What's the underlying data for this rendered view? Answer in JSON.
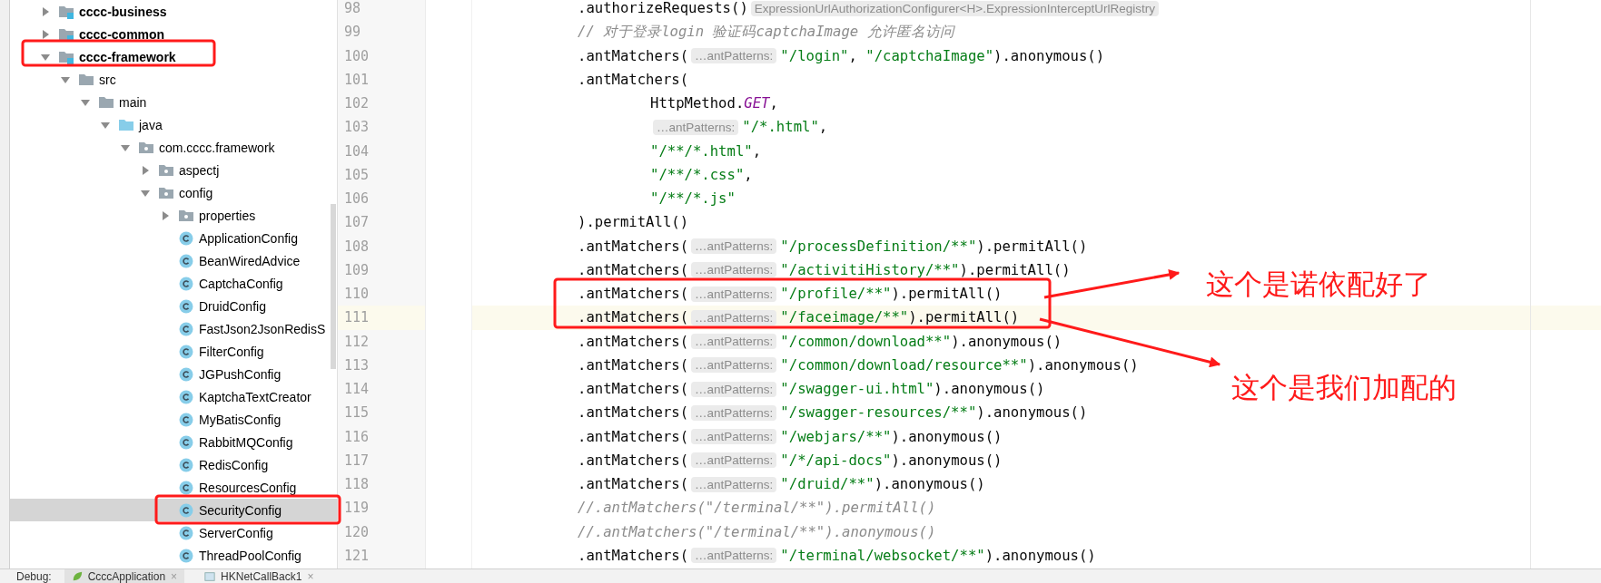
{
  "tree": {
    "items": [
      {
        "label": "cccc-business",
        "kind": "module",
        "expanded": false,
        "selected": false
      },
      {
        "label": "cccc-common",
        "kind": "module",
        "expanded": false,
        "selected": false
      },
      {
        "label": "cccc-framework",
        "kind": "module",
        "expanded": true,
        "selected": false,
        "children": [
          {
            "label": "src",
            "kind": "folder",
            "expanded": true,
            "selected": false,
            "children": [
              {
                "label": "main",
                "kind": "folder",
                "expanded": true,
                "selected": false,
                "children": [
                  {
                    "label": "java",
                    "kind": "source-folder",
                    "expanded": true,
                    "selected": false,
                    "children": [
                      {
                        "label": "com.cccc.framework",
                        "kind": "package",
                        "expanded": true,
                        "selected": false,
                        "children": [
                          {
                            "label": "aspectj",
                            "kind": "package",
                            "expanded": false,
                            "selected": false
                          },
                          {
                            "label": "config",
                            "kind": "package",
                            "expanded": true,
                            "selected": false,
                            "children": [
                              {
                                "label": "properties",
                                "kind": "package",
                                "expanded": false,
                                "selected": false
                              },
                              {
                                "label": "ApplicationConfig",
                                "kind": "class",
                                "selected": false
                              },
                              {
                                "label": "BeanWiredAdvice",
                                "kind": "class",
                                "selected": false
                              },
                              {
                                "label": "CaptchaConfig",
                                "kind": "class",
                                "selected": false
                              },
                              {
                                "label": "DruidConfig",
                                "kind": "class",
                                "selected": false
                              },
                              {
                                "label": "FastJson2JsonRedisS",
                                "kind": "class",
                                "selected": false
                              },
                              {
                                "label": "FilterConfig",
                                "kind": "class",
                                "selected": false
                              },
                              {
                                "label": "JGPushConfig",
                                "kind": "class",
                                "selected": false
                              },
                              {
                                "label": "KaptchaTextCreator",
                                "kind": "class",
                                "selected": false
                              },
                              {
                                "label": "MyBatisConfig",
                                "kind": "class",
                                "selected": false
                              },
                              {
                                "label": "RabbitMQConfig",
                                "kind": "class",
                                "selected": false
                              },
                              {
                                "label": "RedisConfig",
                                "kind": "class",
                                "selected": false
                              },
                              {
                                "label": "ResourcesConfig",
                                "kind": "class",
                                "selected": false
                              },
                              {
                                "label": "SecurityConfig",
                                "kind": "class",
                                "selected": true
                              },
                              {
                                "label": "ServerConfig",
                                "kind": "class",
                                "selected": false
                              },
                              {
                                "label": "ThreadPoolConfig",
                                "kind": "class",
                                "selected": false
                              }
                            ]
                          }
                        ]
                      }
                    ]
                  }
                ]
              }
            ]
          }
        ]
      }
    ]
  },
  "editor": {
    "lines": [
      {
        "number": "98",
        "indented": false,
        "current": false,
        "tokens": [
          {
            "kind": "plain",
            "text": ".authorizeRequests()"
          },
          {
            "kind": "hint",
            "text": "ExpressionUrlAuthorizationConfigurer<H>.ExpressionInterceptUrlRegistry"
          }
        ]
      },
      {
        "number": "99",
        "indented": false,
        "current": false,
        "tokens": [
          {
            "kind": "comment",
            "text": "// 对于登录login 验证码captchaImage 允许匿名访问"
          }
        ]
      },
      {
        "number": "100",
        "indented": false,
        "current": false,
        "tokens": [
          {
            "kind": "plain",
            "text": ".antMatchers("
          },
          {
            "kind": "hint",
            "text": "…antPatterns:"
          },
          {
            "kind": "string",
            "text": "\"/login\""
          },
          {
            "kind": "plain",
            "text": ", "
          },
          {
            "kind": "string",
            "text": "\"/captchaImage\""
          },
          {
            "kind": "plain",
            "text": ").anonymous()"
          }
        ]
      },
      {
        "number": "101",
        "indented": false,
        "current": false,
        "tokens": [
          {
            "kind": "plain",
            "text": ".antMatchers("
          }
        ]
      },
      {
        "number": "102",
        "indented": true,
        "current": false,
        "tokens": [
          {
            "kind": "plain",
            "text": "HttpMethod."
          },
          {
            "kind": "constant",
            "text": "GET"
          },
          {
            "kind": "plain",
            "text": ","
          }
        ]
      },
      {
        "number": "103",
        "indented": true,
        "current": false,
        "tokens": [
          {
            "kind": "hint",
            "text": "…antPatterns:"
          },
          {
            "kind": "string",
            "text": "\"/*.html\""
          },
          {
            "kind": "plain",
            "text": ","
          }
        ]
      },
      {
        "number": "104",
        "indented": true,
        "current": false,
        "tokens": [
          {
            "kind": "string",
            "text": "\"/**/*.html\""
          },
          {
            "kind": "plain",
            "text": ","
          }
        ]
      },
      {
        "number": "105",
        "indented": true,
        "current": false,
        "tokens": [
          {
            "kind": "string",
            "text": "\"/**/*.css\""
          },
          {
            "kind": "plain",
            "text": ","
          }
        ]
      },
      {
        "number": "106",
        "indented": true,
        "current": false,
        "tokens": [
          {
            "kind": "string",
            "text": "\"/**/*.js\""
          }
        ]
      },
      {
        "number": "107",
        "indented": false,
        "current": false,
        "tokens": [
          {
            "kind": "plain",
            "text": ").permitAll()"
          }
        ]
      },
      {
        "number": "108",
        "indented": false,
        "current": false,
        "tokens": [
          {
            "kind": "plain",
            "text": ".antMatchers("
          },
          {
            "kind": "hint",
            "text": "…antPatterns:"
          },
          {
            "kind": "string",
            "text": "\"/processDefinition/**\""
          },
          {
            "kind": "plain",
            "text": ").permitAll()"
          }
        ]
      },
      {
        "number": "109",
        "indented": false,
        "current": false,
        "tokens": [
          {
            "kind": "plain",
            "text": ".antMatchers("
          },
          {
            "kind": "hint",
            "text": "…antPatterns:"
          },
          {
            "kind": "string",
            "text": "\"/activitiHistory/**\""
          },
          {
            "kind": "plain",
            "text": ").permitAll()"
          }
        ]
      },
      {
        "number": "110",
        "indented": false,
        "current": false,
        "tokens": [
          {
            "kind": "plain",
            "text": ".antMatchers("
          },
          {
            "kind": "hint",
            "text": "…antPatterns:"
          },
          {
            "kind": "string",
            "text": "\"/profile/**\""
          },
          {
            "kind": "plain",
            "text": ").permitAll()"
          }
        ]
      },
      {
        "number": "111",
        "indented": false,
        "current": true,
        "tokens": [
          {
            "kind": "plain",
            "text": ".antMatchers("
          },
          {
            "kind": "hint",
            "text": "…antPatterns:"
          },
          {
            "kind": "string",
            "text": "\"/faceimage/**\""
          },
          {
            "kind": "plain",
            "text": ").permitAll()"
          }
        ]
      },
      {
        "number": "112",
        "indented": false,
        "current": false,
        "tokens": [
          {
            "kind": "plain",
            "text": ".antMatchers("
          },
          {
            "kind": "hint",
            "text": "…antPatterns:"
          },
          {
            "kind": "string",
            "text": "\"/common/download**\""
          },
          {
            "kind": "plain",
            "text": ").anonymous()"
          }
        ]
      },
      {
        "number": "113",
        "indented": false,
        "current": false,
        "tokens": [
          {
            "kind": "plain",
            "text": ".antMatchers("
          },
          {
            "kind": "hint",
            "text": "…antPatterns:"
          },
          {
            "kind": "string",
            "text": "\"/common/download/resource**\""
          },
          {
            "kind": "plain",
            "text": ").anonymous()"
          }
        ]
      },
      {
        "number": "114",
        "indented": false,
        "current": false,
        "tokens": [
          {
            "kind": "plain",
            "text": ".antMatchers("
          },
          {
            "kind": "hint",
            "text": "…antPatterns:"
          },
          {
            "kind": "string",
            "text": "\"/swagger-ui.html\""
          },
          {
            "kind": "plain",
            "text": ").anonymous()"
          }
        ]
      },
      {
        "number": "115",
        "indented": false,
        "current": false,
        "tokens": [
          {
            "kind": "plain",
            "text": ".antMatchers("
          },
          {
            "kind": "hint",
            "text": "…antPatterns:"
          },
          {
            "kind": "string",
            "text": "\"/swagger-resources/**\""
          },
          {
            "kind": "plain",
            "text": ").anonymous()"
          }
        ]
      },
      {
        "number": "116",
        "indented": false,
        "current": false,
        "tokens": [
          {
            "kind": "plain",
            "text": ".antMatchers("
          },
          {
            "kind": "hint",
            "text": "…antPatterns:"
          },
          {
            "kind": "string",
            "text": "\"/webjars/**\""
          },
          {
            "kind": "plain",
            "text": ").anonymous()"
          }
        ]
      },
      {
        "number": "117",
        "indented": false,
        "current": false,
        "tokens": [
          {
            "kind": "plain",
            "text": ".antMatchers("
          },
          {
            "kind": "hint",
            "text": "…antPatterns:"
          },
          {
            "kind": "string",
            "text": "\"/*/api-docs\""
          },
          {
            "kind": "plain",
            "text": ").anonymous()"
          }
        ]
      },
      {
        "number": "118",
        "indented": false,
        "current": false,
        "tokens": [
          {
            "kind": "plain",
            "text": ".antMatchers("
          },
          {
            "kind": "hint",
            "text": "…antPatterns:"
          },
          {
            "kind": "string",
            "text": "\"/druid/**\""
          },
          {
            "kind": "plain",
            "text": ").anonymous()"
          }
        ]
      },
      {
        "number": "119",
        "indented": false,
        "current": false,
        "tokens": [
          {
            "kind": "comment",
            "text": "//.antMatchers(\"/terminal/**\").permitAll()"
          }
        ]
      },
      {
        "number": "120",
        "indented": false,
        "current": false,
        "tokens": [
          {
            "kind": "comment",
            "text": "//.antMatchers(\"/terminal/**\").anonymous()"
          }
        ]
      },
      {
        "number": "121",
        "indented": false,
        "current": false,
        "tokens": [
          {
            "kind": "plain",
            "text": ".antMatchers("
          },
          {
            "kind": "hint",
            "text": "…antPatterns:"
          },
          {
            "kind": "string",
            "text": "\"/terminal/websocket/**\""
          },
          {
            "kind": "plain",
            "text": ").anonymous()"
          }
        ]
      }
    ]
  },
  "annotations": [
    {
      "text": "这个是诺依配好了"
    },
    {
      "text": "这个是我们加配的"
    }
  ],
  "debug_bar": {
    "label": "Debug:",
    "tabs": [
      {
        "label": "CcccApplication",
        "close": "×",
        "selected": true
      },
      {
        "label": "HKNetCallBack1",
        "close": "×",
        "selected": false
      }
    ]
  }
}
